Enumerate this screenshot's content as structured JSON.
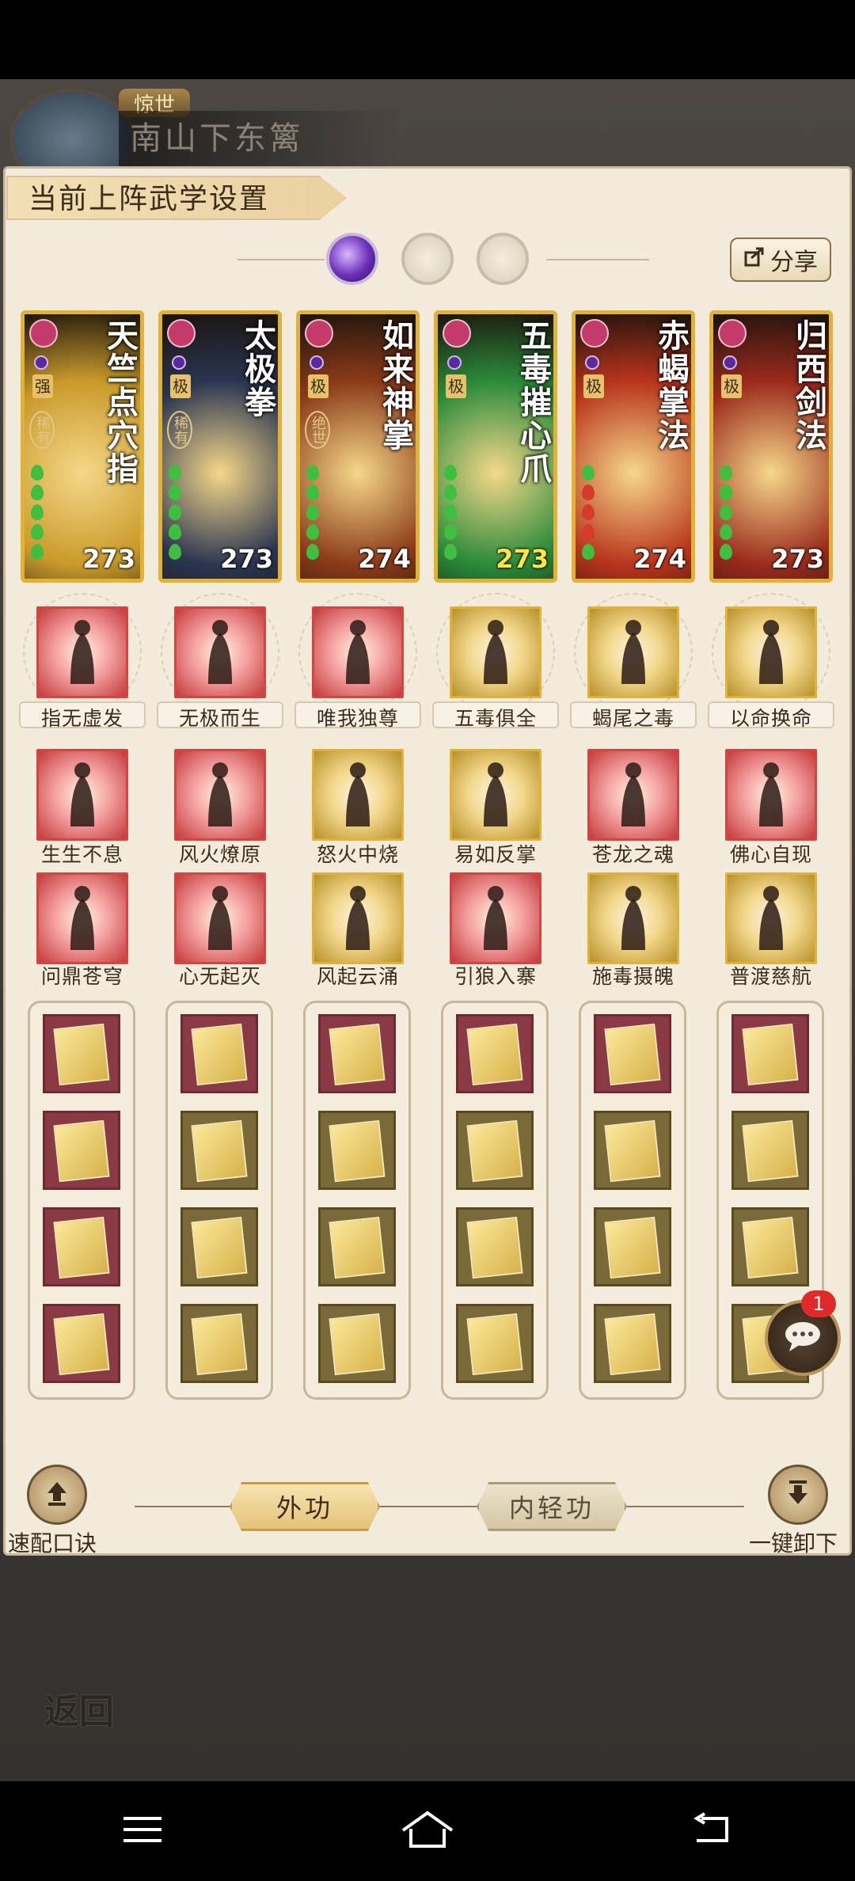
{
  "header": {
    "badge": "惊世",
    "hero_name": "南山下东篱"
  },
  "panel": {
    "title": "当前上阵武学设置",
    "share_label": "分享"
  },
  "cards": [
    {
      "name": "天竺点穴指",
      "grade": "强",
      "rarity": "稀有",
      "power": "273",
      "power_color": "white",
      "theme": "#c99a2a"
    },
    {
      "name": "太极拳",
      "grade": "极",
      "rarity": "稀有",
      "power": "273",
      "power_color": "white",
      "theme": "#2a3550"
    },
    {
      "name": "如来神掌",
      "grade": "极",
      "rarity": "绝世",
      "power": "274",
      "power_color": "white",
      "theme": "#8a3a18"
    },
    {
      "name": "五毒摧心爪",
      "grade": "极",
      "rarity": "",
      "power": "273",
      "power_color": "yellow",
      "theme": "#2a8a3a"
    },
    {
      "name": "赤蝎掌法",
      "grade": "极",
      "rarity": "",
      "power": "274",
      "power_color": "white",
      "theme": "#b8341c"
    },
    {
      "name": "归西剑法",
      "grade": "极",
      "rarity": "",
      "power": "273",
      "power_color": "white",
      "theme": "#9a2a1c"
    }
  ],
  "skill_rows": [
    [
      "指无虚发",
      "无极而生",
      "唯我独尊",
      "五毒俱全",
      "蝎尾之毒",
      "以命换命"
    ],
    [
      "生生不息",
      "风火燎原",
      "怒火中烧",
      "易如反掌",
      "苍龙之魂",
      "佛心自现"
    ],
    [
      "问鼎苍穹",
      "心无起灭",
      "风起云涌",
      "引狼入寨",
      "施毒摄魄",
      "普渡慈航"
    ]
  ],
  "bottom": {
    "quick_label": "速配口诀",
    "tab_outer": "外功",
    "tab_inner": "内轻功",
    "unload_label": "一键卸下",
    "back_label": "返回"
  },
  "chat": {
    "badge": "1"
  },
  "colors": {
    "panel_bg": "#f3ecdc",
    "card_border": "#e2b236",
    "active_orb": "#6b2fb8",
    "badge_red": "#e02a2a"
  }
}
